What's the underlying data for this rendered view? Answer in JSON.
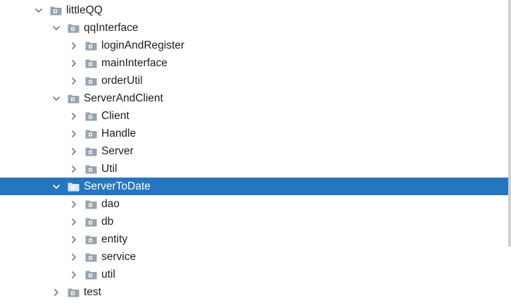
{
  "tree": {
    "nodes": [
      {
        "label": "littleQQ",
        "depth": 0,
        "expanded": true,
        "selected": false,
        "icon": "package-folder-icon"
      },
      {
        "label": "qqInterface",
        "depth": 1,
        "expanded": true,
        "selected": false,
        "icon": "package-folder-icon"
      },
      {
        "label": "loginAndRegister",
        "depth": 2,
        "expanded": false,
        "selected": false,
        "icon": "package-folder-icon"
      },
      {
        "label": "mainInterface",
        "depth": 2,
        "expanded": false,
        "selected": false,
        "icon": "package-folder-icon"
      },
      {
        "label": "orderUtil",
        "depth": 2,
        "expanded": false,
        "selected": false,
        "icon": "package-folder-icon"
      },
      {
        "label": "ServerAndClient",
        "depth": 1,
        "expanded": true,
        "selected": false,
        "icon": "package-folder-icon"
      },
      {
        "label": "Client",
        "depth": 2,
        "expanded": false,
        "selected": false,
        "icon": "package-folder-icon"
      },
      {
        "label": "Handle",
        "depth": 2,
        "expanded": false,
        "selected": false,
        "icon": "package-folder-icon"
      },
      {
        "label": "Server",
        "depth": 2,
        "expanded": false,
        "selected": false,
        "icon": "package-folder-icon"
      },
      {
        "label": "Util",
        "depth": 2,
        "expanded": false,
        "selected": false,
        "icon": "package-folder-icon"
      },
      {
        "label": "ServerToDate",
        "depth": 1,
        "expanded": true,
        "selected": true,
        "icon": "package-folder-icon"
      },
      {
        "label": "dao",
        "depth": 2,
        "expanded": false,
        "selected": false,
        "icon": "package-folder-icon"
      },
      {
        "label": "db",
        "depth": 2,
        "expanded": false,
        "selected": false,
        "icon": "package-folder-icon"
      },
      {
        "label": "entity",
        "depth": 2,
        "expanded": false,
        "selected": false,
        "icon": "package-folder-icon"
      },
      {
        "label": "service",
        "depth": 2,
        "expanded": false,
        "selected": false,
        "icon": "package-folder-icon"
      },
      {
        "label": "util",
        "depth": 2,
        "expanded": false,
        "selected": false,
        "icon": "package-folder-icon"
      },
      {
        "label": "test",
        "depth": 1,
        "expanded": false,
        "selected": false,
        "icon": "package-folder-icon"
      }
    ]
  },
  "colors": {
    "selection": "#2675bf",
    "text": "#1e1e1e",
    "folder": "#9aa4ad",
    "chevron": "#7a7a7a"
  }
}
